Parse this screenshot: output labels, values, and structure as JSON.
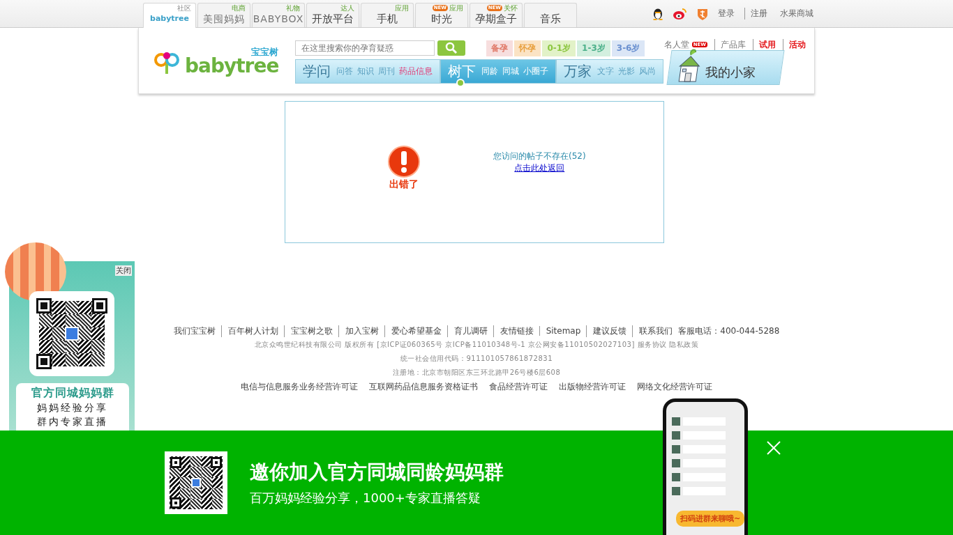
{
  "top_tabs": [
    {
      "tag": "社区",
      "label": "babytree",
      "kind": "logo",
      "selected": true
    },
    {
      "tag": "电商",
      "label": "美囤妈妈",
      "kind": "brand",
      "selected": false
    },
    {
      "tag": "礼物",
      "label": "BABYBOX",
      "kind": "brand",
      "selected": false
    },
    {
      "tag": "达人",
      "label": "开放平台",
      "kind": "text",
      "selected": false
    },
    {
      "tag": "应用",
      "label": "手机",
      "kind": "text",
      "selected": false
    },
    {
      "tag": "应用",
      "label": "时光",
      "kind": "text",
      "badge": "NEW",
      "selected": false
    },
    {
      "tag": "关怀",
      "label": "孕期盒子",
      "kind": "text",
      "badge": "NEW",
      "selected": false
    },
    {
      "label": "音乐",
      "kind": "text",
      "selected": false
    }
  ],
  "account_links": [
    "登录",
    "注册",
    "水果商城"
  ],
  "header": {
    "logo": "babytree",
    "logo_cn": "宝宝树",
    "search_placeholder": "在这里搜索你的孕育疑惑",
    "age_tags": [
      {
        "label": "备孕",
        "color": "#f7dede"
      },
      {
        "label": "怀孕",
        "color": "#fbe3c4"
      },
      {
        "label": "0-1岁",
        "color": "#e2f2c8"
      },
      {
        "label": "1-3岁",
        "color": "#d3efdf"
      },
      {
        "label": "3-6岁",
        "color": "#dbe6f6"
      }
    ],
    "right_links": [
      {
        "label": "名人堂",
        "hot": false,
        "badge": "NEW"
      },
      {
        "label": "产品库",
        "hot": false
      },
      {
        "label": "试用",
        "hot": true
      },
      {
        "label": "活动",
        "hot": true
      }
    ]
  },
  "nav": {
    "sections": [
      {
        "title": "学问",
        "selected": false,
        "items": [
          {
            "label": "问答",
            "highlight": false
          },
          {
            "label": "知识",
            "highlight": false
          },
          {
            "label": "周刊",
            "highlight": false
          },
          {
            "label": "药品信息",
            "highlight": true
          }
        ]
      },
      {
        "title": "树下",
        "selected": true,
        "items": [
          {
            "label": "同龄",
            "highlight": false
          },
          {
            "label": "同城",
            "highlight": false
          },
          {
            "label": "小圈子",
            "highlight": false
          }
        ]
      },
      {
        "title": "万家",
        "selected": false,
        "items": [
          {
            "label": "文字",
            "highlight": false
          },
          {
            "label": "光影",
            "highlight": false
          },
          {
            "label": "风尚",
            "highlight": false
          }
        ]
      }
    ],
    "home": "我的小家"
  },
  "error": {
    "caption": "出错了",
    "message": "您访问的帖子不存在(52)",
    "link": "点击此处返回"
  },
  "footer": {
    "links": [
      "我们宝宝树",
      "百年树人计划",
      "宝宝树之歌",
      "加入宝树",
      "爱心希望基金",
      "育儿调研",
      "友情链接",
      "Sitemap",
      "建议反馈",
      "联系我们"
    ],
    "phone": "客服电话：400-044-5288",
    "lines": [
      "北京众鸣世纪科技有限公司 版权所有 [京ICP证060365号 京ICP备11010348号-1 京公网安备11010502027103] 服务协议 隐私政策",
      "统一社会信用代码：911101057861872831",
      "注册地：北京市朝阳区东三环北路甲26号楼6层608"
    ],
    "licenses": [
      "电信与信息服务业务经营许可证",
      "互联网药品信息服务资格证书",
      "食品经营许可证",
      "出版物经营许可证",
      "网络文化经营许可证"
    ]
  },
  "side_ad": {
    "close": "关闭",
    "title": "官方同城妈妈群",
    "lines": [
      "妈妈经验分享",
      "群内专家直播"
    ]
  },
  "banner": {
    "title": "邀你加入官方同城同龄妈妈群",
    "subtitle": "百万妈妈经验分享，1000+专家直播答疑",
    "bubble": "扫码进群来聊哦~"
  }
}
